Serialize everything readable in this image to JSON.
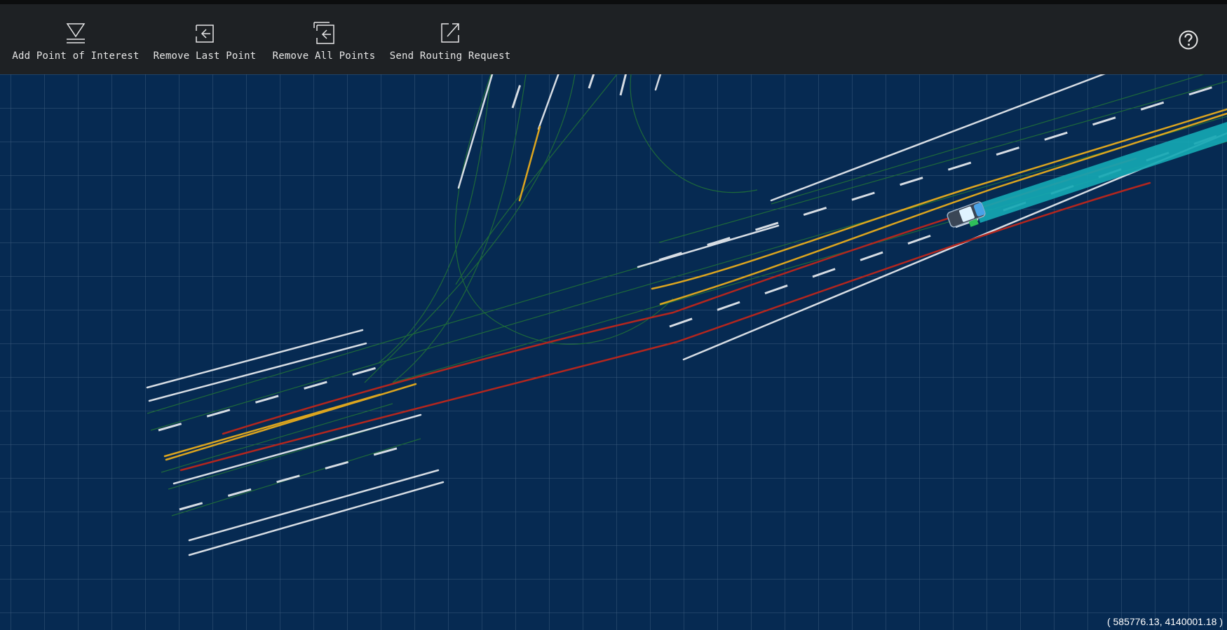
{
  "toolbar": {
    "add_poi": {
      "label": "Add Point of Interest",
      "icon": "add-point-icon"
    },
    "remove_last": {
      "label": "Remove Last Point",
      "icon": "remove-last-icon"
    },
    "remove_all": {
      "label": "Remove All Points",
      "icon": "remove-all-icon"
    },
    "send_routing": {
      "label": "Send Routing Request",
      "icon": "send-icon"
    },
    "help": {
      "icon": "question-icon"
    }
  },
  "map": {
    "coordinates": "( 585776.13, 4140001.18 )",
    "colors": {
      "background": "#062a52",
      "grid": "#3b5a7c",
      "lane_white": "#d7dde4",
      "lane_yellow": "#dca51f",
      "route_red": "#b3261e",
      "lane_center_green": "#1e6a3a",
      "planning_path": "#15a7b3"
    }
  }
}
